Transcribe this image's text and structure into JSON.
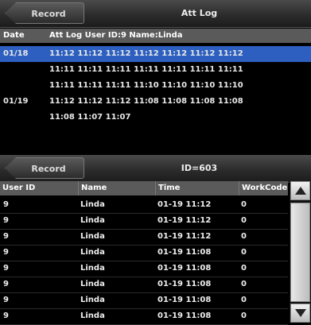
{
  "top": {
    "back_label": "Record",
    "title": "Att Log",
    "header": {
      "date": "Date",
      "info": "Att Log User ID:9 Name:Linda"
    },
    "rows": [
      {
        "date": "01/18",
        "times": "11:12 11:12 11:12 11:12 11:12 11:12 11:12",
        "selected": true
      },
      {
        "date": "",
        "times": "11:11 11:11 11:11 11:11 11:11 11:11 11:11",
        "selected": false
      },
      {
        "date": "",
        "times": "11:11 11:11 11:11 11:10 11:10 11:10 11:10",
        "selected": false
      },
      {
        "date": "01/19",
        "times": "11:12 11:12 11:12 11:08 11:08 11:08 11:08",
        "selected": false
      },
      {
        "date": "",
        "times": "11:08 11:07 11:07",
        "selected": false
      }
    ]
  },
  "bottom": {
    "back_label": "Record",
    "title": "ID=603",
    "columns": [
      "User ID",
      "Name",
      "Time",
      "WorkCode"
    ],
    "rows": [
      {
        "user_id": "9",
        "name": "Linda",
        "time": "01-19 11:12",
        "workcode": "0"
      },
      {
        "user_id": "9",
        "name": "Linda",
        "time": "01-19 11:12",
        "workcode": "0"
      },
      {
        "user_id": "9",
        "name": "Linda",
        "time": "01-19 11:12",
        "workcode": "0"
      },
      {
        "user_id": "9",
        "name": "Linda",
        "time": "01-19 11:08",
        "workcode": "0"
      },
      {
        "user_id": "9",
        "name": "Linda",
        "time": "01-19 11:08",
        "workcode": "0"
      },
      {
        "user_id": "9",
        "name": "Linda",
        "time": "01-19 11:08",
        "workcode": "0"
      },
      {
        "user_id": "9",
        "name": "Linda",
        "time": "01-19 11:08",
        "workcode": "0"
      },
      {
        "user_id": "9",
        "name": "Linda",
        "time": "01-19 11:08",
        "workcode": "0"
      }
    ]
  },
  "colors": {
    "selection": "#2c5fbf",
    "header": "#5a5a5a",
    "background": "#000000"
  },
  "icons": {
    "scroll_up": "triangle-up-icon",
    "scroll_down": "triangle-down-icon"
  }
}
